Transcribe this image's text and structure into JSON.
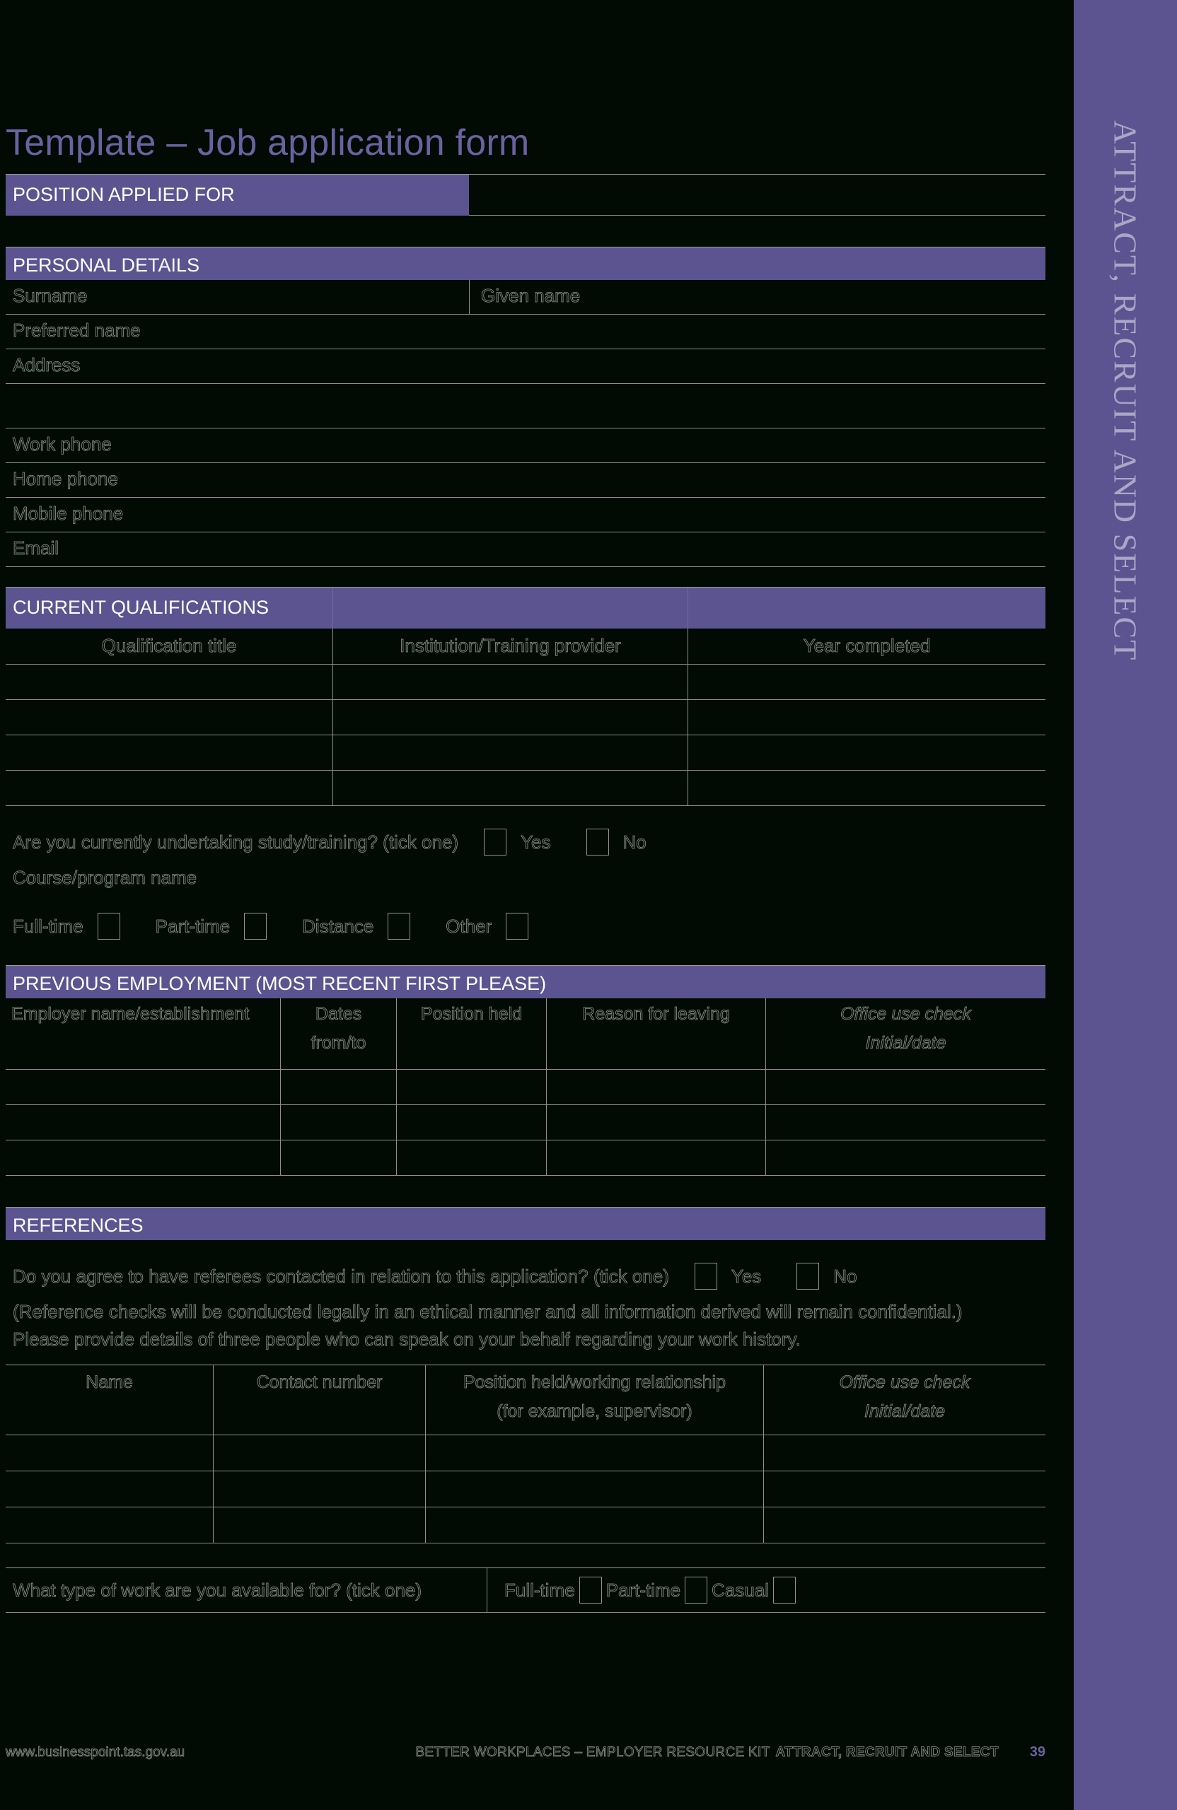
{
  "document": {
    "title": "Template – Job application form",
    "side_tab": "ATTRACT, RECRUIT AND SELECT"
  },
  "position_applied": {
    "label": "POSITION APPLIED FOR",
    "value": ""
  },
  "personal_details": {
    "heading": "PERSONAL DETAILS",
    "fields": {
      "surname": "Surname",
      "given_name": "Given name",
      "preferred_name": "Preferred name",
      "address": "Address",
      "work_phone": "Work phone",
      "home_phone": "Home phone",
      "mobile_phone": "Mobile phone",
      "email": "Email"
    }
  },
  "current_qualifications": {
    "heading": "CURRENT QUALIFICATIONS",
    "columns": [
      "Qualification title",
      "Institution/Training provider",
      "Year completed"
    ],
    "row_count": 4,
    "study_question": "Are you currently undertaking study/training? (tick one)",
    "study_options": [
      "Yes",
      "No"
    ],
    "course_label": "Course/program name",
    "mode_options": [
      "Full-time",
      "Part-time",
      "Distance",
      "Other"
    ]
  },
  "previous_employment": {
    "heading": "PREVIOUS EMPLOYMENT (MOST RECENT FIRST PLEASE)",
    "columns": [
      "Employer name/establishment",
      "Dates",
      "Position held",
      "Reason for leaving",
      "Office use check"
    ],
    "column_sub": {
      "dates": "from/to",
      "office": "Initial/date"
    },
    "row_count": 3
  },
  "references": {
    "heading": "REFERENCES",
    "question": "Do you agree to have referees contacted in relation to this application? (tick one)",
    "options": [
      "Yes",
      "No"
    ],
    "note": "(Reference checks will be conducted legally in an ethical manner and all information derived will remain confidential.)",
    "instruction": "Please provide details of three people who can speak on your behalf regarding your work history.",
    "columns": [
      "Name",
      "Contact number",
      "Position held/working relationship",
      "Office use check"
    ],
    "column_sub": {
      "position": "(for example, supervisor)",
      "office": "Initial/date"
    },
    "row_count": 3
  },
  "availability": {
    "question": "What type of work are you available for? (tick one)",
    "options": [
      "Full-time",
      "Part-time",
      "Casual"
    ]
  },
  "footer": {
    "website": "www.businesspoint.tas.gov.au",
    "kit": "BETTER WORKPLACES – EMPLOYER RESOURCE KIT",
    "section": "ATTRACT, RECRUIT AND SELECT",
    "page": "39"
  },
  "colors": {
    "accent_purple": "#5b5490",
    "title_purple": "#6a62a0",
    "page_bg": "#010a03",
    "rule": "#8d918d"
  }
}
